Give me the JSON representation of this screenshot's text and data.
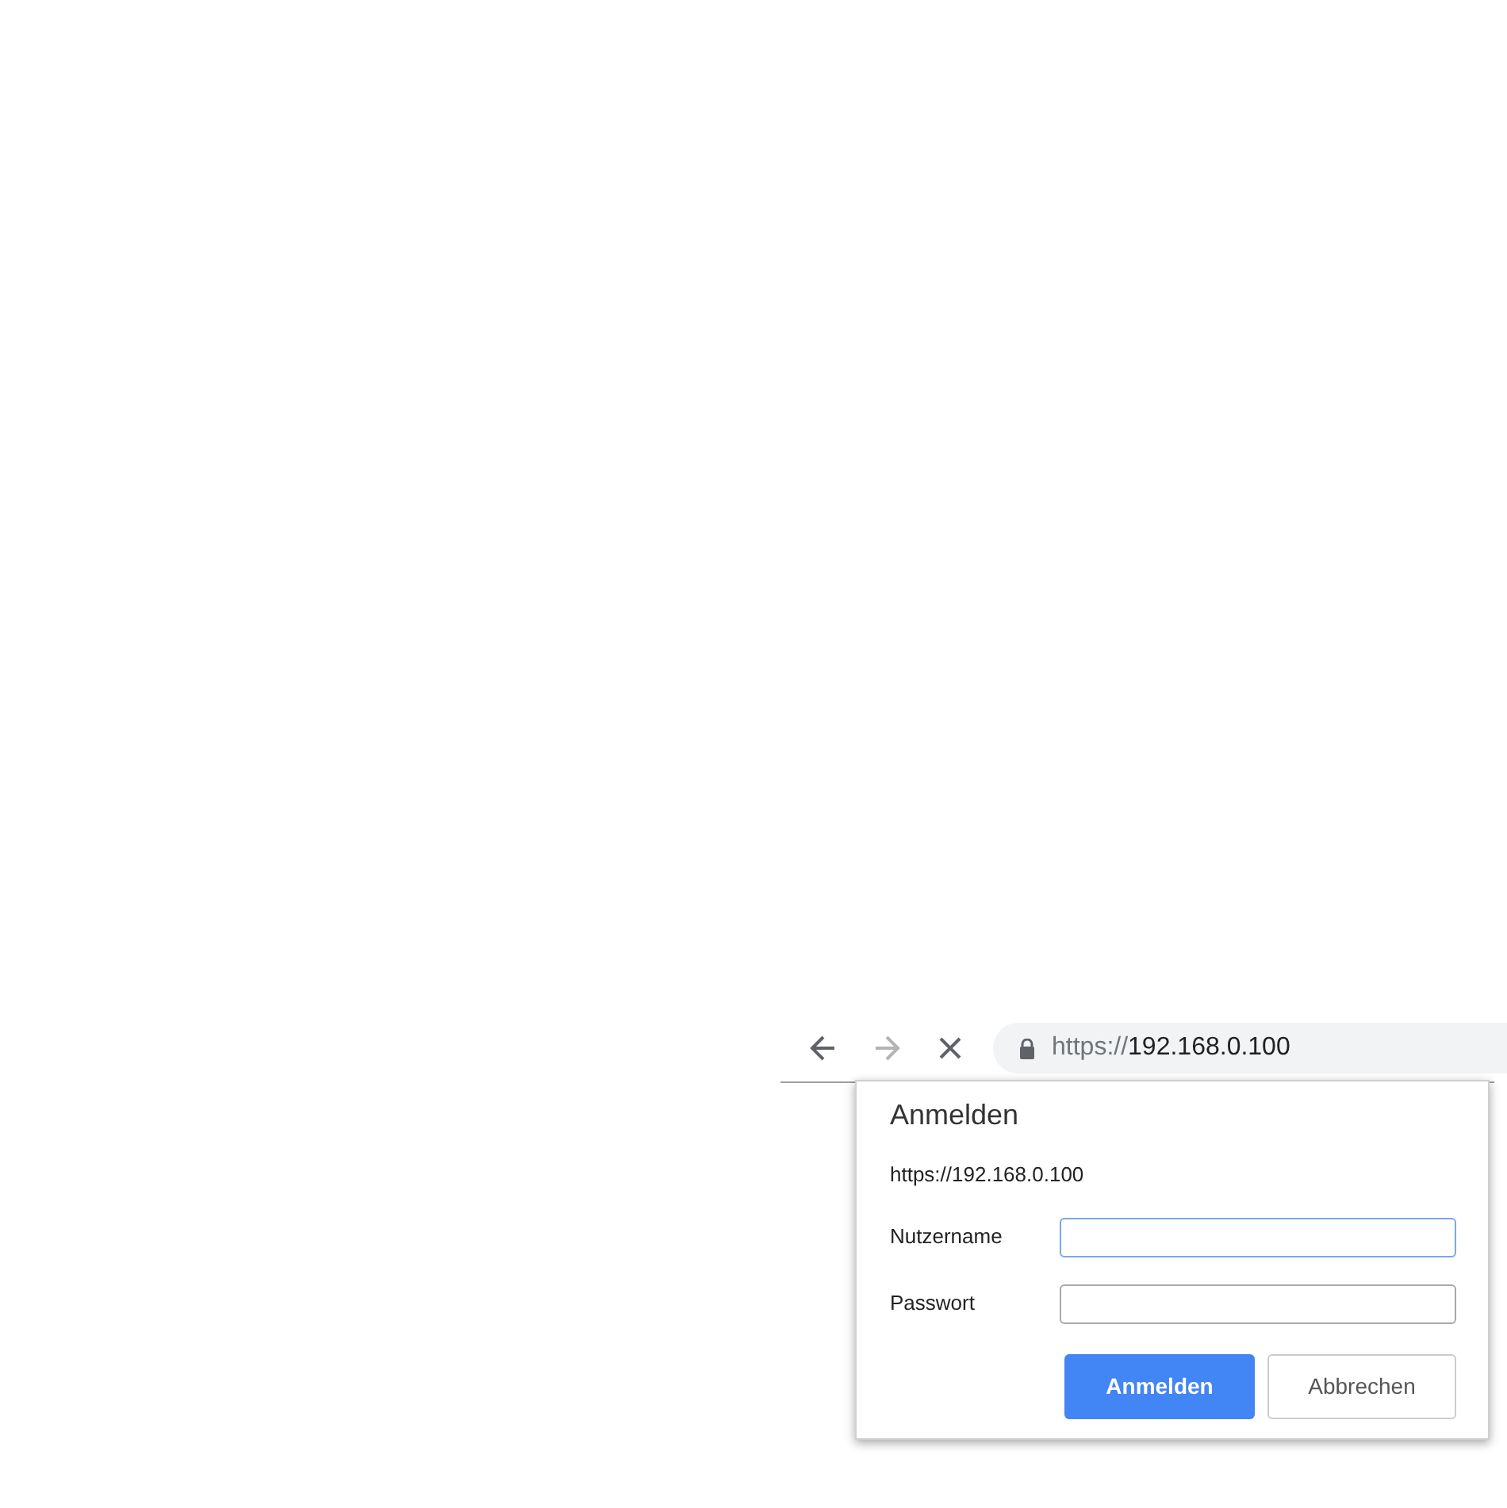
{
  "toolbar": {
    "back": {
      "disabled": false
    },
    "forward": {
      "disabled": true
    },
    "address": {
      "scheme": "https://",
      "host": "192.168.0.100"
    }
  },
  "dialog": {
    "title": "Anmelden",
    "origin": "https://192.168.0.100",
    "fields": [
      {
        "label": "Nutzername",
        "focused": true
      },
      {
        "label": "Passwort",
        "focused": false
      }
    ],
    "buttons": [
      {
        "label": "Anmelden",
        "kind": "primary"
      },
      {
        "label": "Abbrechen",
        "kind": "secondary"
      }
    ]
  }
}
